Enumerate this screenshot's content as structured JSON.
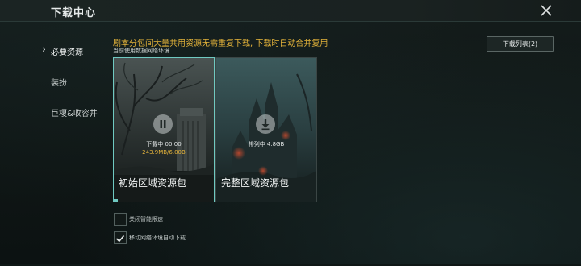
{
  "header": {
    "title": "下载中心"
  },
  "sidebar": {
    "items": [
      {
        "label": "必要资源",
        "active": true
      },
      {
        "label": "装扮",
        "active": false
      },
      {
        "label": "巨榎&收容井",
        "active": false
      }
    ]
  },
  "main": {
    "notice": "剧本分包间大量共用资源无需重复下载, 下载时自动合并复用",
    "network_label": "当前使用数据网络环境",
    "list_button": "下载列表(2)",
    "packs": [
      {
        "name": "初始区域资源包",
        "status_line1": "下载中 00:00",
        "status_line2": "243.9MB/6.00B",
        "state": "downloading",
        "icon": "pause-icon",
        "progress": 0.04
      },
      {
        "name": "完整区域资源包",
        "status_line1": "排列中 4.8GB",
        "state": "queued",
        "icon": "download-icon"
      }
    ],
    "options": [
      {
        "label": "关闭智能限速",
        "checked": false
      },
      {
        "label": "移动网络环境自动下载",
        "checked": true
      }
    ]
  },
  "colors": {
    "accent": "#6fc9c1",
    "warning_text": "#e5b43a"
  }
}
